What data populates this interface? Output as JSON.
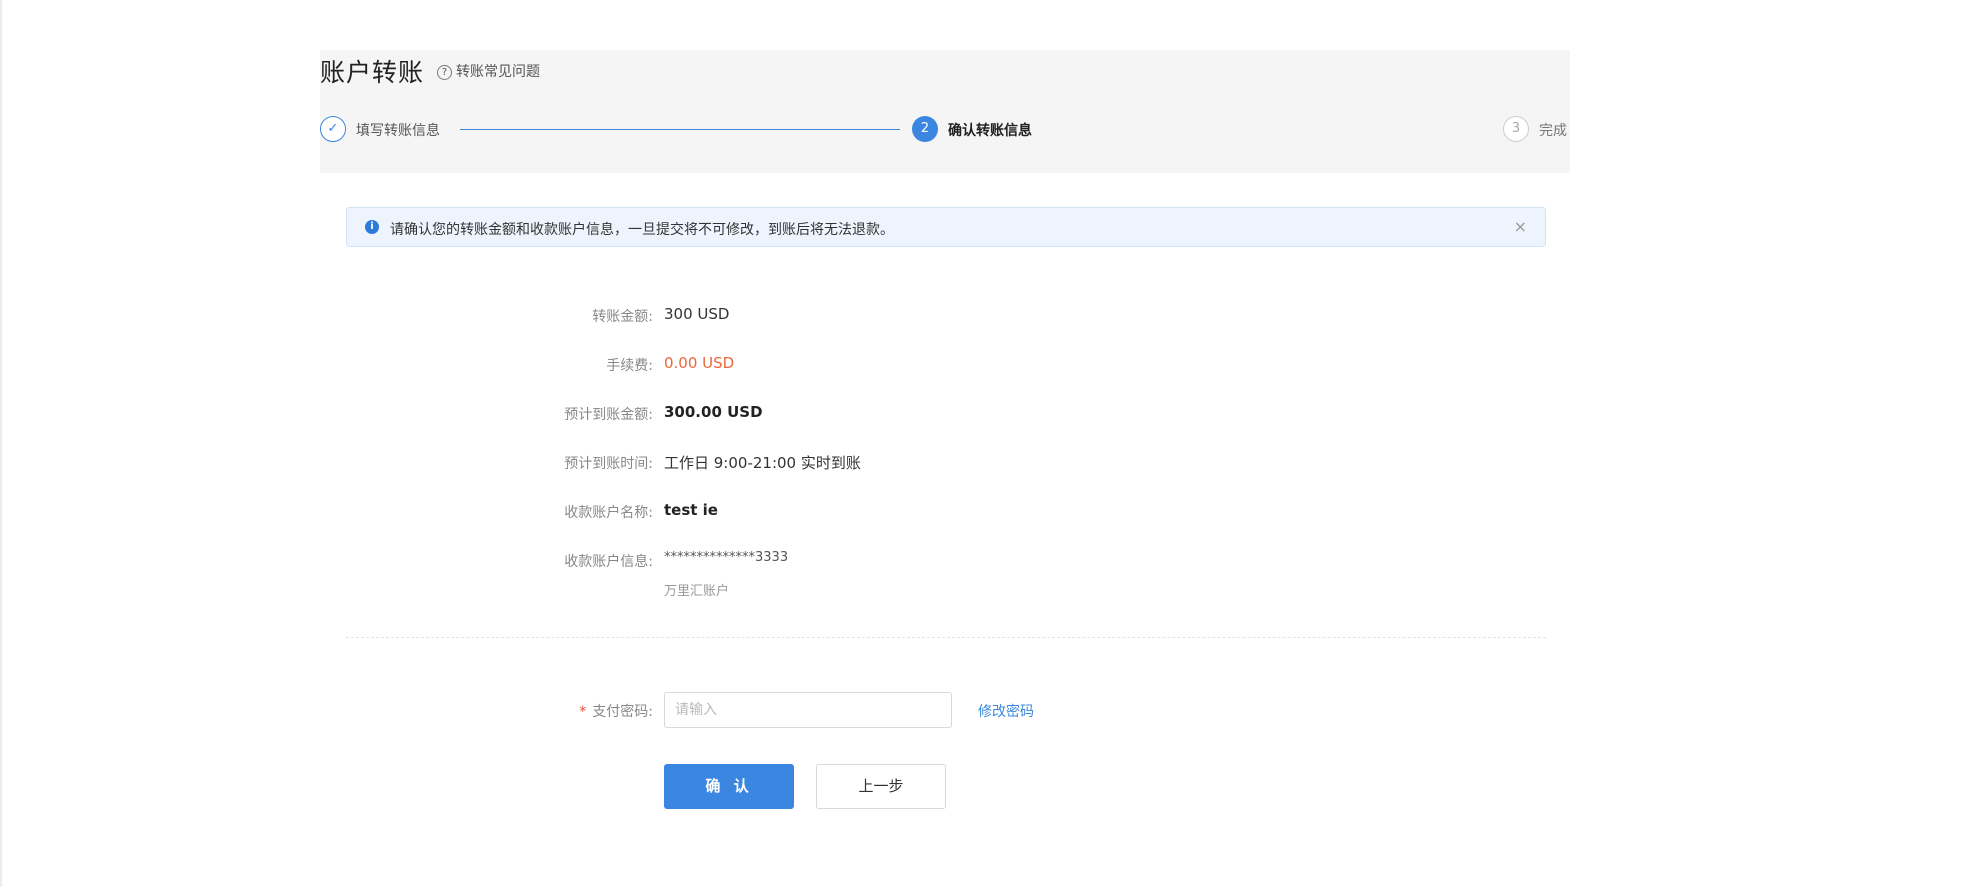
{
  "header": {
    "title": "账户转账",
    "faq_link": "转账常见问题"
  },
  "steps": [
    {
      "number": "✓",
      "label": "填写转账信息",
      "state": "done"
    },
    {
      "number": "2",
      "label": "确认转账信息",
      "state": "active"
    },
    {
      "number": "3",
      "label": "完成",
      "state": "pending"
    }
  ],
  "alert": {
    "icon": "info-icon",
    "text": "请确认您的转账金额和收款账户信息，一旦提交将不可修改，到账后将无法退款。",
    "close": "×"
  },
  "details": {
    "amount": {
      "label": "转账金额:",
      "value": "300 USD"
    },
    "fee": {
      "label": "手续费:",
      "value": "0.00 USD"
    },
    "expected_amount": {
      "label": "预计到账金额:",
      "value": "300.00 USD"
    },
    "expected_time": {
      "label": "预计到账时间:",
      "value": "工作日 9:00-21:00 实时到账"
    },
    "payee_name": {
      "label": "收款账户名称:",
      "value": "test ie"
    },
    "payee_info": {
      "label": "收款账户信息:",
      "value": "**************3333",
      "sub": "万里汇账户"
    }
  },
  "password": {
    "required_mark": "*",
    "label": "支付密码:",
    "placeholder": "请输入",
    "value": "",
    "change_link": "修改密码"
  },
  "buttons": {
    "confirm": "确 认",
    "back": "上一步"
  },
  "colors": {
    "accent": "#3b86e0",
    "fee": "#e8673c",
    "required": "#e84c3d"
  }
}
